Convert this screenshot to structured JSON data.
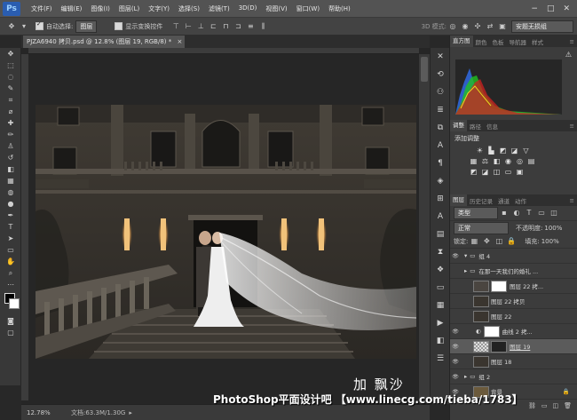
{
  "app": {
    "logo": "Ps"
  },
  "menu": [
    "文件(F)",
    "编辑(E)",
    "图像(I)",
    "图层(L)",
    "文字(Y)",
    "选择(S)",
    "滤镜(T)",
    "3D(D)",
    "视图(V)",
    "窗口(W)",
    "帮助(H)"
  ],
  "window_controls": [
    "−",
    "□",
    "✕"
  ],
  "options": {
    "auto_select_label": "自动选择:",
    "auto_select_value": "图层",
    "show_transform_label": "显示变换控件",
    "mode_3d": "3D 模式:",
    "workspace": "安题无损组"
  },
  "document_tab": {
    "title": "PJZA6940 拷贝.psd @ 12.8% (图层 19, RGB/8) *",
    "close": "×"
  },
  "status": {
    "zoom": "12.78%",
    "doc_label": "文档:63.3M/1.30G"
  },
  "histogram_panel": {
    "tabs": [
      "直方图",
      "颜色",
      "色板",
      "导航器",
      "样式"
    ],
    "active": 0
  },
  "adjust_panel": {
    "tabs": [
      "调整",
      "路径",
      "信息"
    ],
    "active": 0,
    "title": "添加调整"
  },
  "layers_panel": {
    "tabs": [
      "图层",
      "历史记录",
      "通道",
      "动作"
    ],
    "active": 0,
    "filter_kind": "类型",
    "blend_mode": "正常",
    "opacity_label": "不透明度:",
    "opacity_value": "100%",
    "lock_label": "锁定:",
    "fill_label": "填充:",
    "fill_value": "100%",
    "layers": [
      {
        "name": "组 4",
        "type": "group",
        "visible": true
      },
      {
        "name": "在那一天我们的婚礼 ...",
        "type": "group",
        "visible": false
      },
      {
        "name": "图层 22 拷...",
        "type": "masked",
        "visible": false
      },
      {
        "name": "图层 22 拷贝",
        "type": "pixel",
        "visible": false
      },
      {
        "name": "图层 22",
        "type": "pixel",
        "visible": false
      },
      {
        "name": "曲线 2 拷...",
        "type": "adjust",
        "visible": true
      },
      {
        "name": "图层 19",
        "type": "masked",
        "visible": true,
        "selected": true
      },
      {
        "name": "图层 18",
        "type": "pixel",
        "visible": true
      },
      {
        "name": "组 2",
        "type": "group",
        "visible": true
      },
      {
        "name": "背景",
        "type": "background",
        "visible": true
      }
    ]
  },
  "overlay": {
    "signature": "加 飘沙",
    "watermark": "PhotoShop平面设计吧 【www.linecg.com/tieba/1783】"
  },
  "colors": {
    "accent": "#2a5db0",
    "selection": "#5b5b5b"
  }
}
